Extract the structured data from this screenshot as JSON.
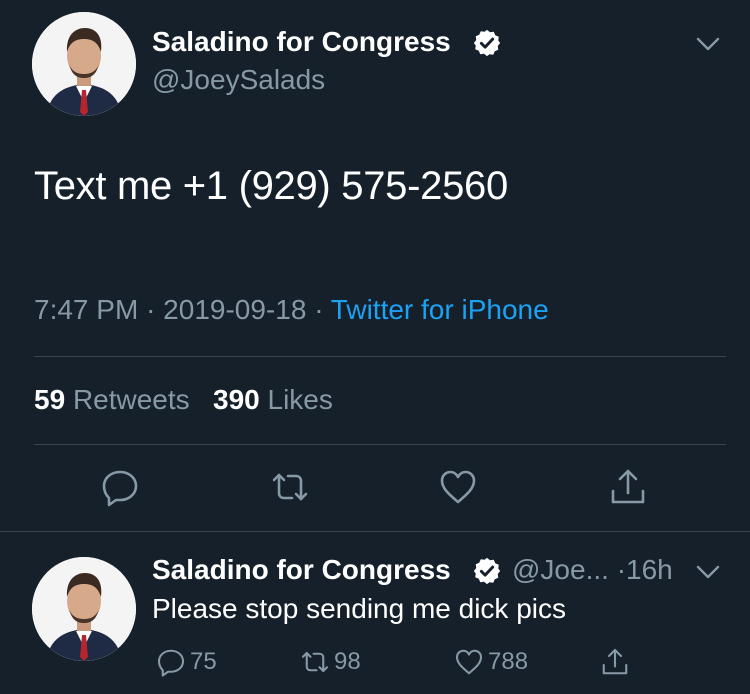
{
  "main_tweet": {
    "display_name": "Saladino for Congress",
    "handle": "@JoeySalads",
    "text": "Text me +1 (929) 575-2560",
    "time": "7:47 PM",
    "separator": "·",
    "date": "2019-09-18",
    "source": "Twitter for iPhone",
    "retweets_count": "59",
    "retweets_label": "Retweets",
    "likes_count": "390",
    "likes_label": "Likes",
    "icons": [
      "reply-icon",
      "retweet-icon",
      "like-icon",
      "share-icon"
    ]
  },
  "reply_tweet": {
    "display_name": "Saladino for Congress",
    "handle": "@Joe...",
    "separator": "·",
    "age": "16h",
    "text": "Please stop sending me dick pics",
    "reply_count": "75",
    "retweet_count": "98",
    "like_count": "788"
  },
  "colors": {
    "background": "#15202b",
    "text_primary": "#ffffff",
    "text_secondary": "#8899a6",
    "link": "#1da1f2",
    "divider": "#38444d"
  }
}
